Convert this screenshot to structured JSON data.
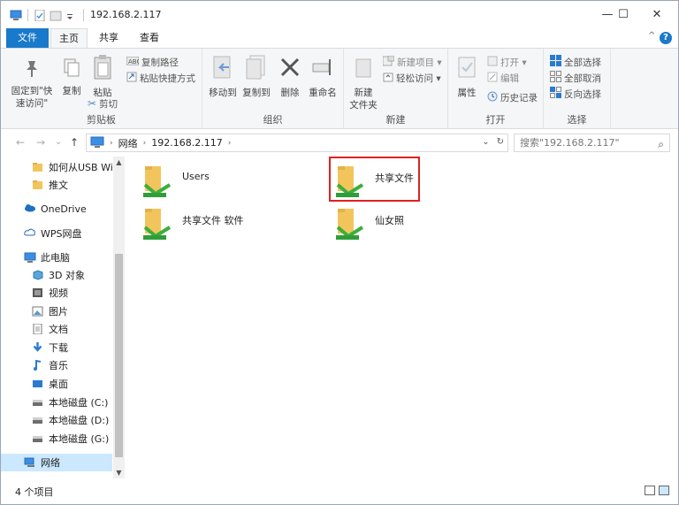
{
  "window": {
    "title": "192.168.2.117",
    "minimize": "—",
    "maximize": "☐",
    "close": "✕"
  },
  "tabs": {
    "file": "文件",
    "home": "主页",
    "share": "共享",
    "view": "查看"
  },
  "ribbon": {
    "collapse": "^",
    "help": "?",
    "clipboard": {
      "label": "剪贴板",
      "pin_line1": "固定到\"快",
      "pin_line2": "速访问\"",
      "copy": "复制",
      "paste": "粘贴",
      "copy_path": "复制路径",
      "paste_shortcut": "粘贴快捷方式",
      "cut": "剪切"
    },
    "organize": {
      "label": "组织",
      "move_to": "移动到",
      "copy_to": "复制到",
      "delete": "删除",
      "rename": "重命名"
    },
    "new": {
      "label": "新建",
      "new_folder_line1": "新建",
      "new_folder_line2": "文件夹",
      "new_item": "新建项目 ▾",
      "easy_access": "轻松访问 ▾"
    },
    "open": {
      "label": "打开",
      "properties": "属性",
      "open": "打开 ▾",
      "edit": "编辑",
      "history": "历史记录"
    },
    "select": {
      "label": "选择",
      "select_all": "全部选择",
      "select_none": "全部取消",
      "invert": "反向选择"
    }
  },
  "address": {
    "back": "←",
    "forward": "→",
    "recent": "⌄",
    "up": "↑",
    "crumbs": [
      "网络",
      "192.168.2.117"
    ],
    "separator": "›",
    "dropdown": "⌄",
    "refresh": "↻",
    "search_placeholder": "搜索\"192.168.2.117\"",
    "search_icon": "⌕"
  },
  "navpane": {
    "items": [
      {
        "label": "如何从USB Win",
        "icon": "folder-icon",
        "indent": 1
      },
      {
        "label": "推文",
        "icon": "folder-icon",
        "indent": 1
      },
      {
        "label": "OneDrive",
        "icon": "cloud-icon",
        "indent": 0
      },
      {
        "label": "WPS网盘",
        "icon": "cloud-outline-icon",
        "indent": 0
      },
      {
        "label": "此电脑",
        "icon": "computer-icon",
        "indent": 0
      },
      {
        "label": "3D 对象",
        "icon": "cube-icon",
        "indent": 1
      },
      {
        "label": "视频",
        "icon": "video-icon",
        "indent": 1
      },
      {
        "label": "图片",
        "icon": "picture-icon",
        "indent": 1
      },
      {
        "label": "文档",
        "icon": "document-icon",
        "indent": 1
      },
      {
        "label": "下载",
        "icon": "download-icon",
        "indent": 1
      },
      {
        "label": "音乐",
        "icon": "music-icon",
        "indent": 1
      },
      {
        "label": "桌面",
        "icon": "desktop-icon",
        "indent": 1
      },
      {
        "label": "本地磁盘 (C:)",
        "icon": "drive-icon",
        "indent": 1
      },
      {
        "label": "本地磁盘 (D:)",
        "icon": "drive-icon",
        "indent": 1
      },
      {
        "label": "本地磁盘 (G:)",
        "icon": "drive-icon",
        "indent": 1
      },
      {
        "label": "网络",
        "icon": "network-icon",
        "indent": 0
      }
    ],
    "scroll_up": "▲",
    "scroll_down": "▼"
  },
  "files": [
    {
      "name": "Users"
    },
    {
      "name": "共享文件"
    },
    {
      "name": "共享文件 软件"
    },
    {
      "name": "仙女照"
    }
  ],
  "status": {
    "count": "4 个项目"
  },
  "colors": {
    "accent": "#1979ca",
    "folder": "#f2c55c",
    "highlight": "#e02020",
    "share_arrow": "#3cae3c"
  }
}
